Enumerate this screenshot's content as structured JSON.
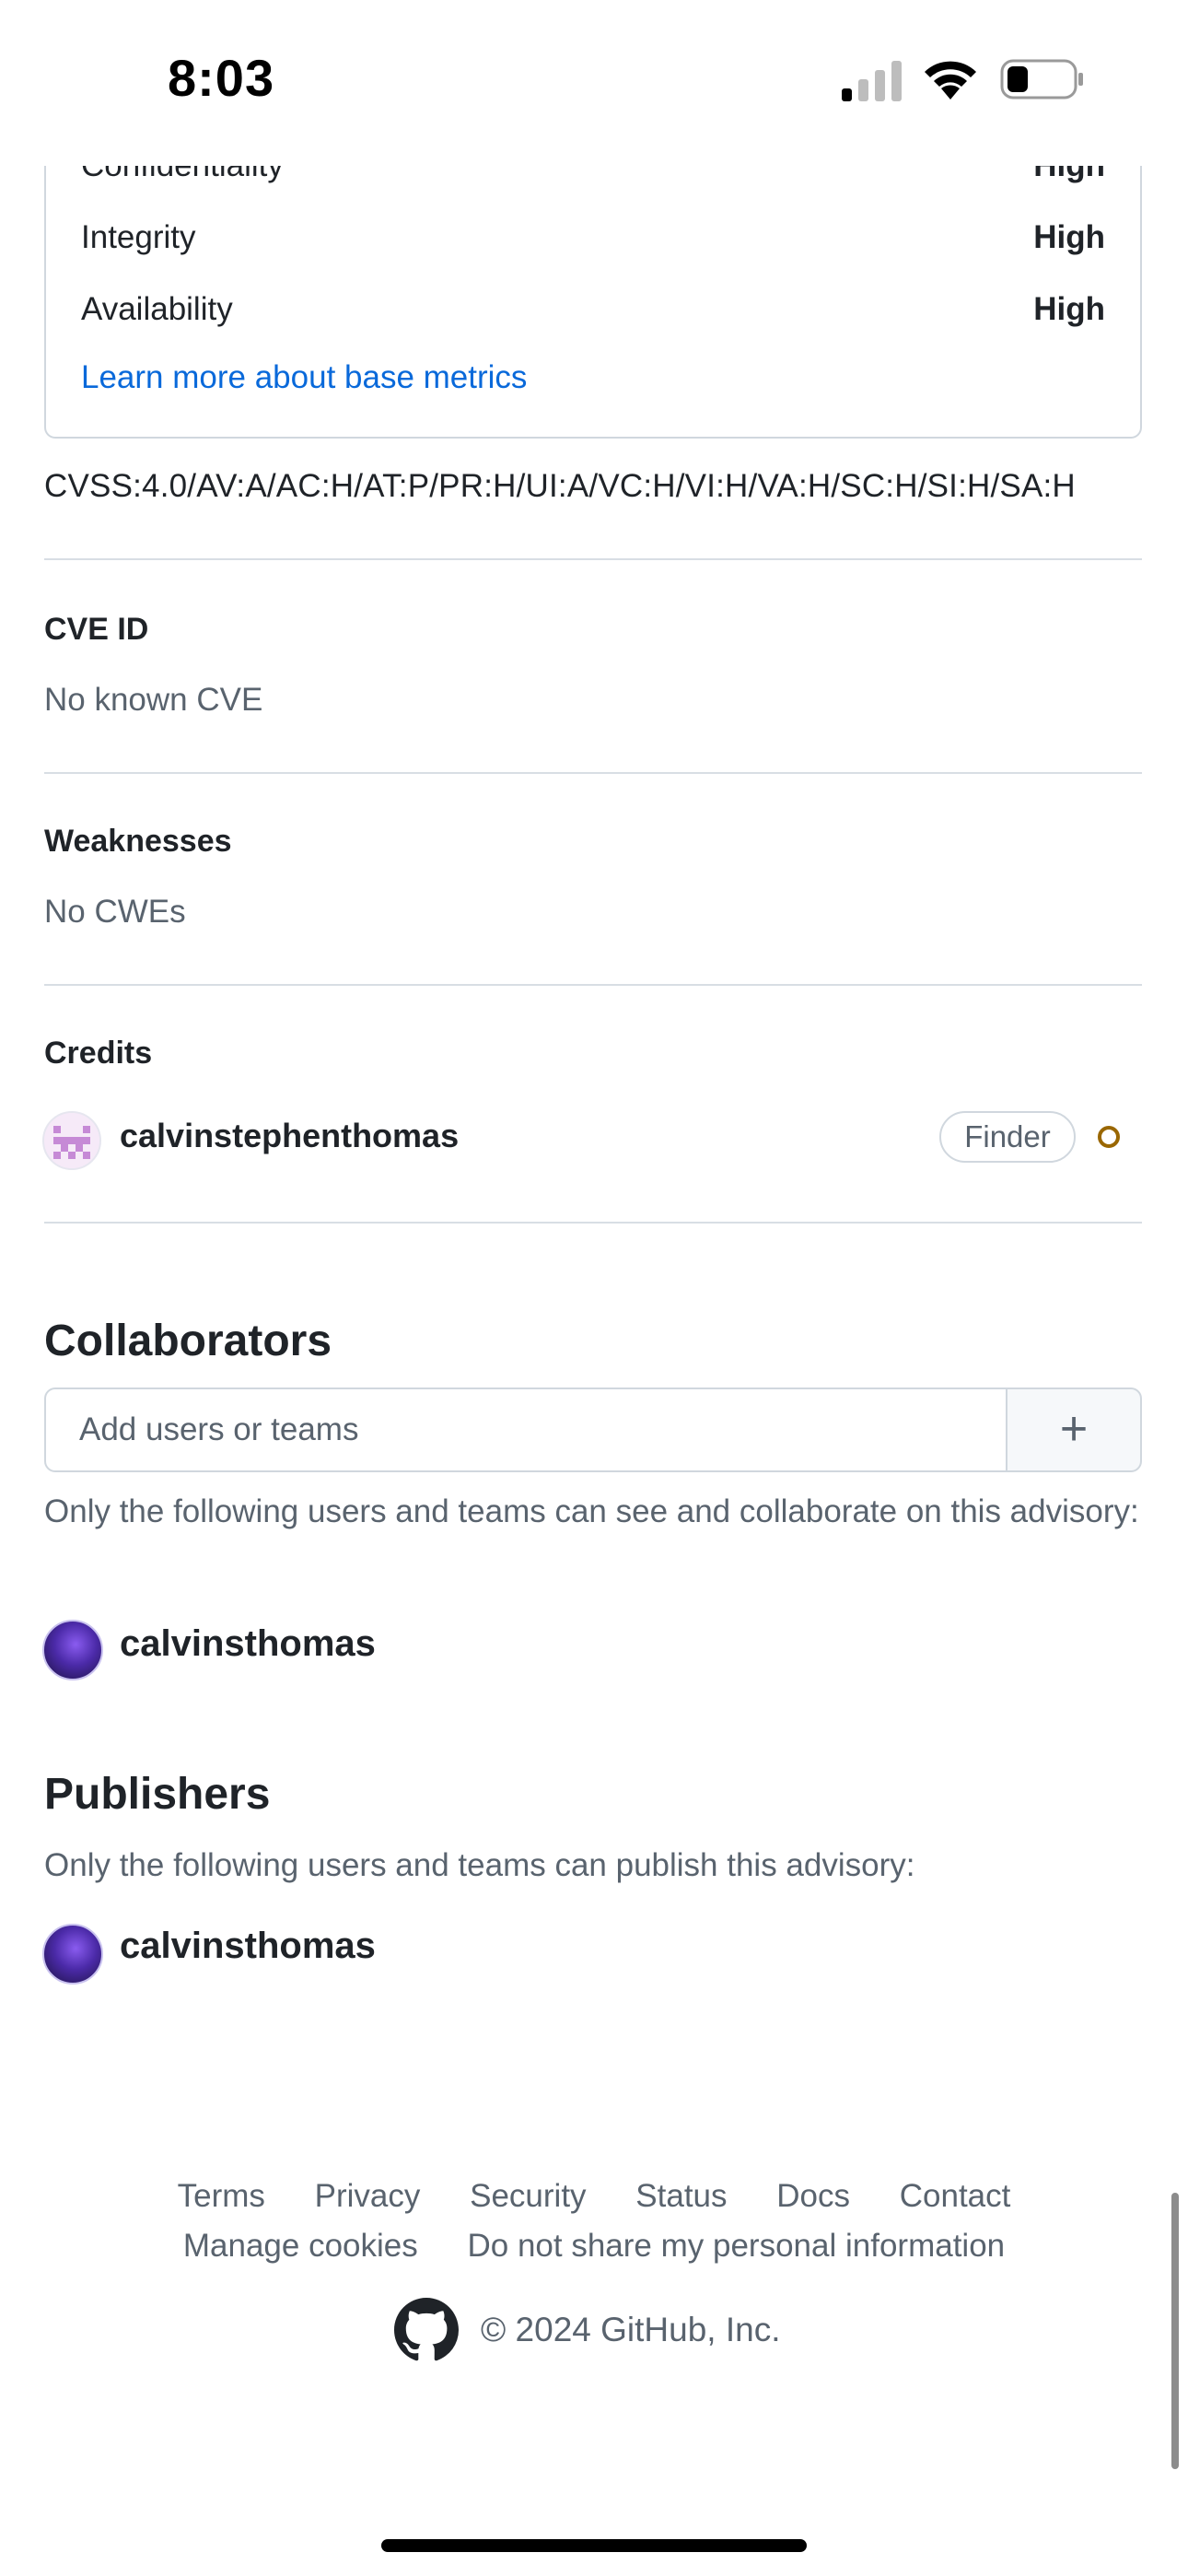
{
  "status_bar": {
    "time": "8:03"
  },
  "metrics": {
    "partial_label": "Confidentiality",
    "partial_value": "High",
    "rows": [
      {
        "label": "Integrity",
        "value": "High"
      },
      {
        "label": "Availability",
        "value": "High"
      }
    ],
    "learn_more": "Learn more about base metrics"
  },
  "vector_string": "CVSS:4.0/AV:A/AC:H/AT:P/PR:H/UI:A/VC:H/VI:H/VA:H/SC:H/SI:H/SA:H",
  "cve": {
    "title": "CVE ID",
    "value": "No known CVE"
  },
  "weaknesses": {
    "title": "Weaknesses",
    "value": "No CWEs"
  },
  "credits": {
    "title": "Credits",
    "items": [
      {
        "username": "calvinstephenthomas",
        "role": "Finder"
      }
    ]
  },
  "collaborators": {
    "title": "Collaborators",
    "input_placeholder": "Add users or teams",
    "add_button": "+",
    "description": "Only the following users and teams can see and collaborate on this advisory:",
    "users": [
      "calvinsthomas"
    ]
  },
  "publishers": {
    "title": "Publishers",
    "description": "Only the following users and teams can publish this advisory:",
    "users": [
      "calvinsthomas"
    ]
  },
  "footer": {
    "links_row1": [
      "Terms",
      "Privacy",
      "Security",
      "Status",
      "Docs",
      "Contact"
    ],
    "links_row2": [
      "Manage cookies",
      "Do not share my personal information"
    ],
    "copyright": "© 2024 GitHub, Inc."
  }
}
